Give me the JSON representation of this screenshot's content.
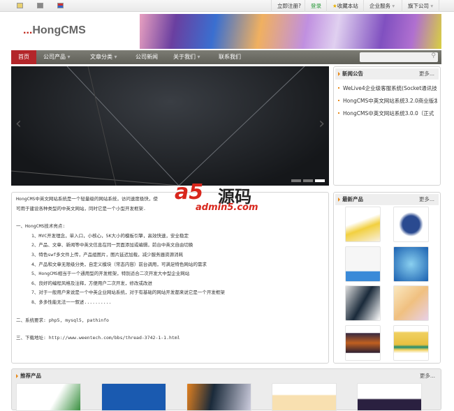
{
  "topbar": {
    "icons": [
      "home-icon",
      "monitor-icon",
      "flag-icon"
    ],
    "register": "立即注册?",
    "login": "登录",
    "bookmark": "收藏本站",
    "services": "企业服务",
    "subsidiaries": "旗下公司"
  },
  "header": {
    "logo_dots": "...",
    "logo_text": "HongCMS"
  },
  "nav": {
    "items": [
      "首页",
      "公司产品",
      "文章分类",
      "公司新闻",
      "关于我们",
      "联系我们"
    ],
    "search_placeholder": ""
  },
  "news": {
    "title": "新闻公告",
    "more": "更多...",
    "items": [
      "WeLive4企业级客服系统(Socket通讯技",
      "HongCMS中英文网站系统3.2.0商业版发",
      "HongCMS中英文网站系统3.0.0（正式"
    ]
  },
  "intro": {
    "lines": [
      "HongCMS中英文网站系统是一个轻量级的网站系统，访问速度极快，使",
      "可用于建设各种类型的中英文网站，同时它是一个小型开发框架."
    ],
    "section1": "一、HongCMS技术亮点:",
    "points": [
      "1、MVC开发理念，单入口，小核心，5K大小的模板引擎，高效快速，安全稳定",
      "2、产品、文章、新闻等中英文信息在同一页面添加或编辑，前台中英文自由切换",
      "3、特色swf多文件上传，产品组图片，图片延迟加载，减少服务器资源消耗",
      "4、产品和文章无限级分类，自定义模块（常态内容）前台调用，可满足特色网站的需求",
      "5、HongCMS相当于一个通用型的开发框架，特别适合二次开发大中型企业网站",
      "6、良好的编程风格及注释，方便用户二次开发，修改或改进",
      "7、对于一般用户来说是一个中英企业网站系统，对于有基础的网站开发都来说它是一个开发框架",
      "8、多多性能无法一一叙述.........."
    ],
    "section2": "二、系统要求: php5, mysql5, pathinfo",
    "section3": "三、下载地址: http://www.weentech.com/bbs/thread-3742-1-1.html"
  },
  "watermark": {
    "logo": "a5",
    "name": "源码",
    "domain": "admin5.com"
  },
  "latest": {
    "title": "最新产品",
    "more": "更多..."
  },
  "recommend": {
    "title": "推荐产品",
    "more": "更多..."
  }
}
